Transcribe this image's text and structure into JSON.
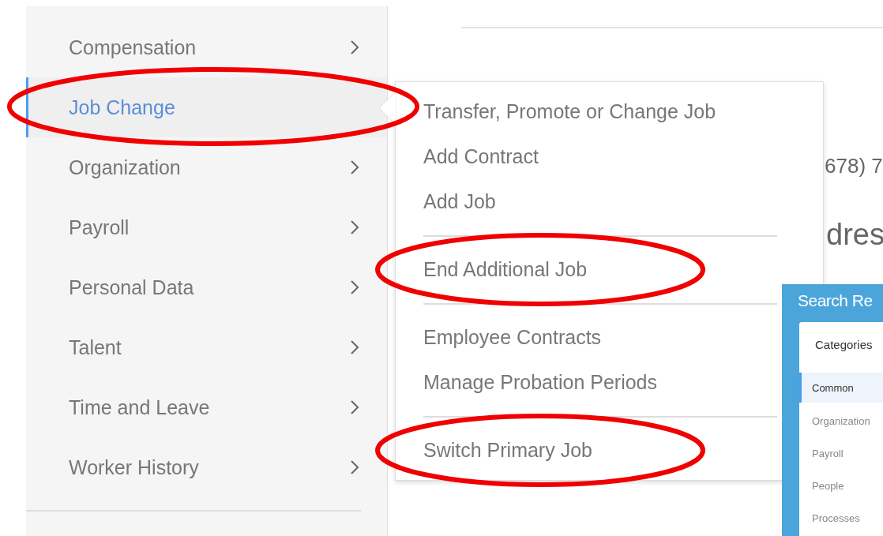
{
  "sidebar": {
    "items": [
      {
        "label": "Compensation",
        "selected": false,
        "circled": false
      },
      {
        "label": "Job Change",
        "selected": true,
        "circled": true
      },
      {
        "label": "Organization",
        "selected": false,
        "circled": false
      },
      {
        "label": "Payroll",
        "selected": false,
        "circled": false
      },
      {
        "label": "Personal Data",
        "selected": false,
        "circled": false
      },
      {
        "label": "Talent",
        "selected": false,
        "circled": false
      },
      {
        "label": "Time and Leave",
        "selected": false,
        "circled": false
      },
      {
        "label": "Worker History",
        "selected": false,
        "circled": false
      }
    ]
  },
  "submenu": {
    "items": [
      {
        "kind": "item",
        "label": "Transfer, Promote or Change Job",
        "circled": false
      },
      {
        "kind": "item",
        "label": "Add Contract",
        "circled": false
      },
      {
        "kind": "item",
        "label": "Add Job",
        "circled": false
      },
      {
        "kind": "divider"
      },
      {
        "kind": "item",
        "label": "End Additional Job",
        "circled": true
      },
      {
        "kind": "divider"
      },
      {
        "kind": "item",
        "label": "Employee Contracts",
        "circled": false
      },
      {
        "kind": "item",
        "label": "Manage Probation Periods",
        "circled": false
      },
      {
        "kind": "divider"
      },
      {
        "kind": "item",
        "label": "Switch Primary Job",
        "circled": true
      }
    ]
  },
  "background_text": {
    "phone": "678) 7",
    "heading": "dres"
  },
  "search_results": {
    "title": "Search Re",
    "categories_heading": "Categories",
    "categories": [
      {
        "label": "Common",
        "selected": true
      },
      {
        "label": "Organization",
        "selected": false
      },
      {
        "label": "Payroll",
        "selected": false
      },
      {
        "label": "People",
        "selected": false
      },
      {
        "label": "Processes",
        "selected": false
      }
    ]
  }
}
